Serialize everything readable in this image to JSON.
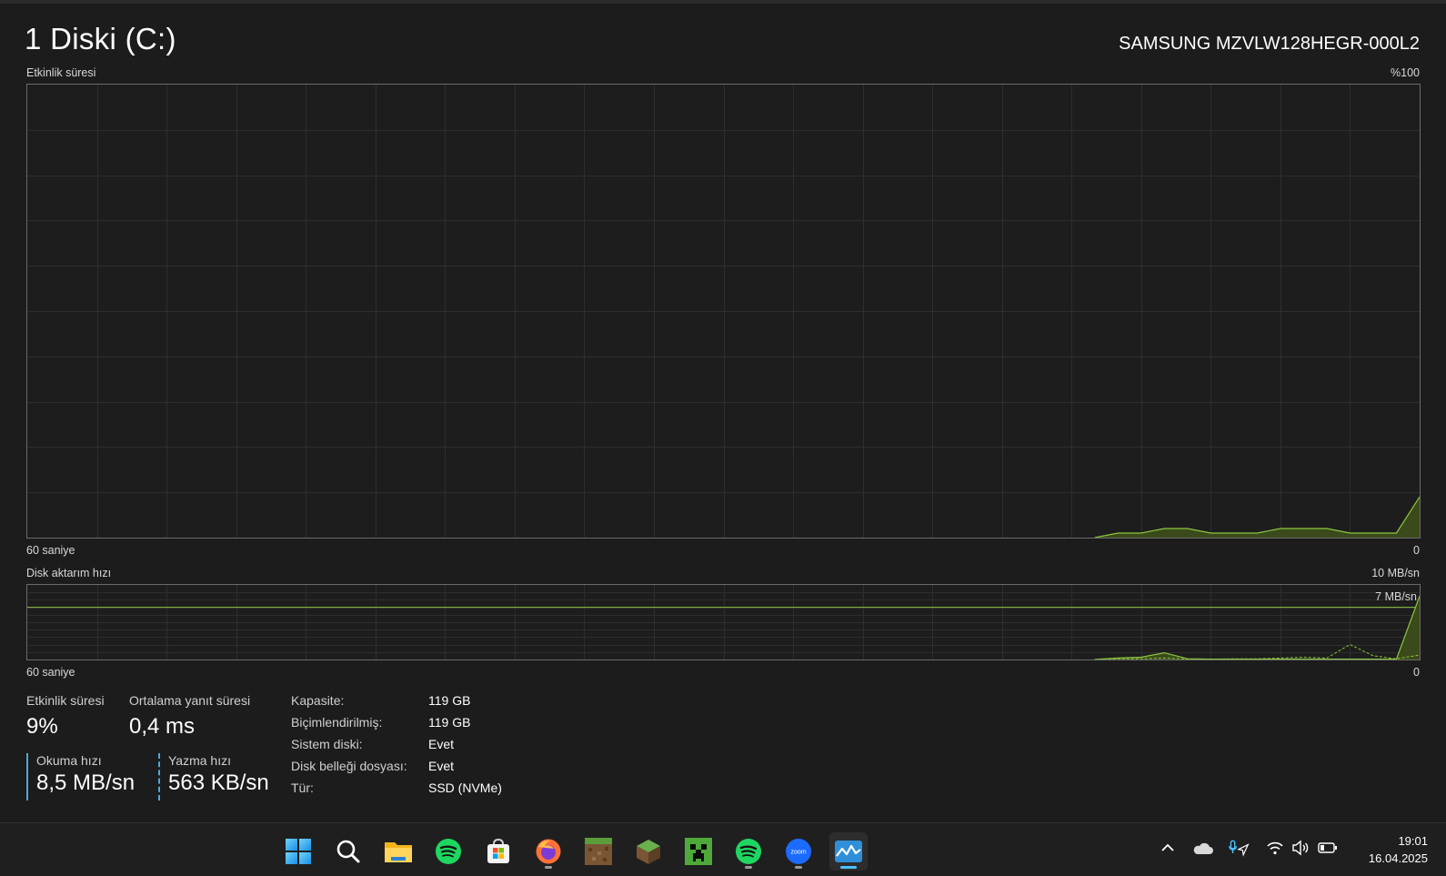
{
  "header": {
    "title": "1 Diski (C:)",
    "model": "SAMSUNG MZVLW128HEGR-000L2"
  },
  "activity_graph": {
    "label": "Etkinlik süresi",
    "max_label": "%100",
    "x_left_label": "60 saniye",
    "x_right_label": "0"
  },
  "transfer_graph": {
    "label": "Disk aktarım hızı",
    "max_label": "10 MB/sn",
    "line_label": "7 MB/sn",
    "x_left_label": "60 saniye",
    "x_right_label": "0"
  },
  "chart_data": [
    {
      "type": "area",
      "title": "Etkinlik süresi",
      "x_range_seconds": [
        60,
        0
      ],
      "ylim": [
        0,
        100
      ],
      "unit": "%",
      "grid": true,
      "series": [
        {
          "x": [
            14,
            13,
            12,
            11,
            10,
            9,
            8,
            7,
            6,
            5,
            4,
            3,
            2,
            1,
            0
          ],
          "values": [
            0,
            1,
            1,
            2,
            2,
            1,
            1,
            1,
            2,
            2,
            2,
            1,
            1,
            1,
            9
          ]
        }
      ]
    },
    {
      "type": "area",
      "title": "Disk aktarım hızı",
      "x_range_seconds": [
        60,
        0
      ],
      "ylim": [
        0,
        10
      ],
      "unit": "MB/sn",
      "reference_line": 7,
      "grid": true,
      "series": [
        {
          "x": [
            14,
            13,
            12,
            11,
            10,
            9,
            8,
            7,
            6,
            5,
            4,
            3,
            2,
            1,
            0
          ],
          "values": [
            0,
            0.2,
            0.3,
            0.9,
            0.1,
            0.05,
            0.05,
            0.05,
            0.05,
            0.05,
            0.05,
            0.05,
            0.05,
            0.05,
            8.5
          ]
        },
        {
          "dashed": true,
          "x": [
            14,
            13,
            12,
            11,
            10,
            9,
            8,
            7,
            6,
            5,
            4,
            3,
            2,
            1,
            0
          ],
          "values": [
            0,
            0.1,
            0.1,
            0.2,
            0.05,
            0.05,
            0.1,
            0.1,
            0.2,
            0.3,
            0.2,
            2.0,
            0.5,
            0.1,
            0.6
          ]
        }
      ]
    }
  ],
  "stats": {
    "activity": {
      "label": "Etkinlik süresi",
      "value": "9%"
    },
    "response": {
      "label": "Ortalama yanıt süresi",
      "value": "0,4 ms"
    },
    "read": {
      "label": "Okuma hızı",
      "value": "8,5 MB/sn"
    },
    "write": {
      "label": "Yazma hızı",
      "value": "563 KB/sn"
    }
  },
  "info": [
    {
      "key": "Kapasite:",
      "value": "119 GB"
    },
    {
      "key": "Biçimlendirilmiş:",
      "value": "119 GB"
    },
    {
      "key": "Sistem diski:",
      "value": "Evet"
    },
    {
      "key": "Disk belleği dosyası:",
      "value": "Evet"
    },
    {
      "key": "Tür:",
      "value": "SSD (NVMe)"
    }
  ],
  "colors": {
    "graph_line": "#8cc63f",
    "graph_fill": "#3a4a1a",
    "grid": "#2e2e2e",
    "accent": "#4cc2ff"
  },
  "taskbar": {
    "apps": [
      {
        "name": "start-icon",
        "running": false,
        "active": false
      },
      {
        "name": "search-icon",
        "running": false,
        "active": false
      },
      {
        "name": "file-explorer-icon",
        "running": false,
        "active": false
      },
      {
        "name": "spotify-icon",
        "running": false,
        "active": false
      },
      {
        "name": "microsoft-store-icon",
        "running": false,
        "active": false
      },
      {
        "name": "firefox-icon",
        "running": true,
        "active": false
      },
      {
        "name": "minecraft-dirt-block-icon",
        "running": false,
        "active": false
      },
      {
        "name": "minecraft-grass-block-icon",
        "running": false,
        "active": false
      },
      {
        "name": "minecraft-creeper-icon",
        "running": false,
        "active": false
      },
      {
        "name": "spotify-icon",
        "running": true,
        "active": false
      },
      {
        "name": "zoom-icon",
        "running": true,
        "active": false
      },
      {
        "name": "task-manager-icon",
        "running": true,
        "active": true
      }
    ],
    "zoom_label": "zoom",
    "tray": [
      "chevron-up-icon",
      "onedrive-cloud-icon",
      "microphone-location-icon",
      "wifi-icon",
      "volume-icon",
      "battery-icon"
    ],
    "time": "19:01",
    "date": "16.04.2025"
  }
}
